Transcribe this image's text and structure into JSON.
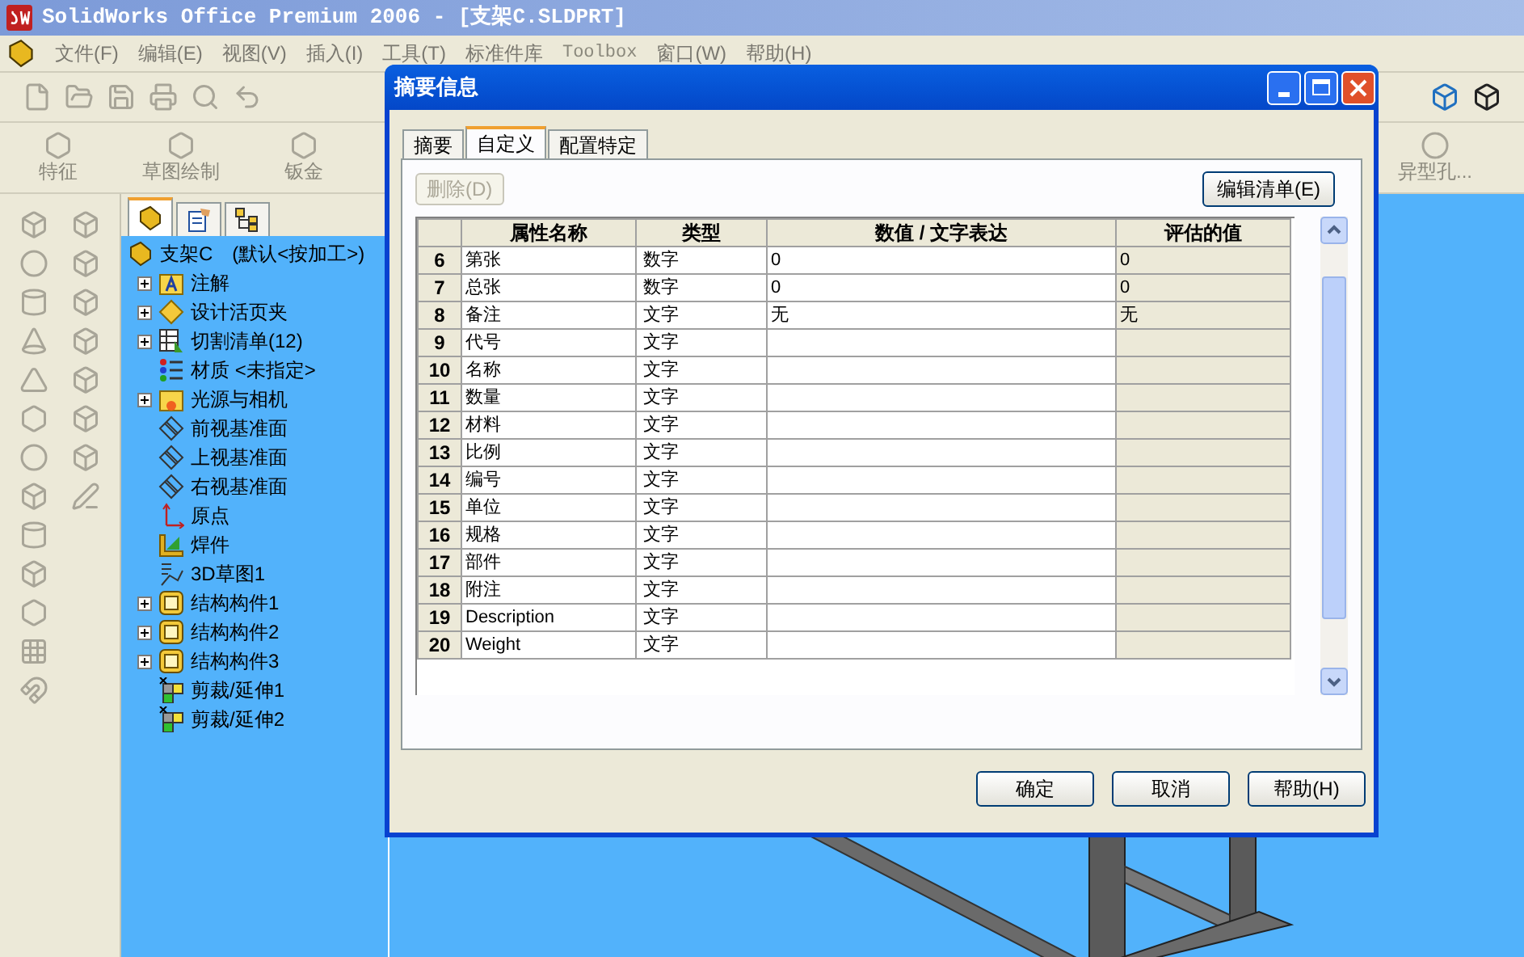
{
  "window": {
    "title": "SolidWorks Office Premium 2006 - [支架C.SLDPRT]"
  },
  "menu": [
    "文件(F)",
    "编辑(E)",
    "视图(V)",
    "插入(I)",
    "工具(T)",
    "标准件库",
    "Toolbox",
    "窗口(W)",
    "帮助(H)"
  ],
  "command_bar": {
    "left": [
      "特征",
      "草图绘制",
      "钣金"
    ],
    "right": [
      "异型孔..."
    ]
  },
  "feature_tree": {
    "tabs": [
      {
        "kind": "feature",
        "selected": true
      },
      {
        "kind": "property",
        "selected": false
      },
      {
        "kind": "configuration",
        "selected": false
      }
    ],
    "root": {
      "label": "支架C",
      "config": "(默认<按加工>)"
    },
    "items": [
      {
        "kind": "annotation",
        "label": "注解",
        "expandable": true
      },
      {
        "kind": "binder",
        "label": "设计活页夹",
        "expandable": true
      },
      {
        "kind": "cutlist",
        "label": "切割清单(12)",
        "expandable": true
      },
      {
        "kind": "material",
        "label": "材质 <未指定>",
        "expandable": false
      },
      {
        "kind": "lights",
        "label": "光源与相机",
        "expandable": true
      },
      {
        "kind": "plane",
        "label": "前视基准面",
        "expandable": false
      },
      {
        "kind": "plane",
        "label": "上视基准面",
        "expandable": false
      },
      {
        "kind": "plane",
        "label": "右视基准面",
        "expandable": false
      },
      {
        "kind": "origin",
        "label": "原点",
        "expandable": false
      },
      {
        "kind": "weldment",
        "label": "焊件",
        "expandable": false
      },
      {
        "kind": "sketch",
        "label": "3D草图1",
        "expandable": false
      },
      {
        "kind": "member",
        "label": "结构构件1",
        "expandable": true
      },
      {
        "kind": "member",
        "label": "结构构件2",
        "expandable": true
      },
      {
        "kind": "member",
        "label": "结构构件3",
        "expandable": true
      },
      {
        "kind": "trim",
        "label": "剪裁/延伸1",
        "expandable": false
      },
      {
        "kind": "trim",
        "label": "剪裁/延伸2",
        "expandable": false
      }
    ]
  },
  "dialog": {
    "title": "摘要信息",
    "tabs": [
      {
        "label": "摘要",
        "selected": false
      },
      {
        "label": "自定义",
        "selected": true
      },
      {
        "label": "配置特定",
        "selected": false
      }
    ],
    "delete_button": {
      "label": "删除(D)",
      "disabled": true
    },
    "edit_list_button": {
      "label": "编辑清单(E)",
      "disabled": false
    },
    "table": {
      "columns": [
        "属性名称",
        "类型",
        "数值 / 文字表达",
        "评估的值"
      ],
      "rows": [
        {
          "number": "6",
          "name": "第张",
          "type": "数字",
          "value": "0",
          "evaluated": "0"
        },
        {
          "number": "7",
          "name": "总张",
          "type": "数字",
          "value": "0",
          "evaluated": "0"
        },
        {
          "number": "8",
          "name": "备注",
          "type": "文字",
          "value": "无",
          "evaluated": "无"
        },
        {
          "number": "9",
          "name": "代号",
          "type": "文字"
        },
        {
          "number": "10",
          "name": "名称",
          "type": "文字"
        },
        {
          "number": "11",
          "name": "数量",
          "type": "文字"
        },
        {
          "number": "12",
          "name": "材料",
          "type": "文字"
        },
        {
          "number": "13",
          "name": "比例",
          "type": "文字"
        },
        {
          "number": "14",
          "name": "编号",
          "type": "文字"
        },
        {
          "number": "15",
          "name": "单位",
          "type": "文字"
        },
        {
          "number": "16",
          "name": "规格",
          "type": "文字"
        },
        {
          "number": "17",
          "name": "部件",
          "type": "文字"
        },
        {
          "number": "18",
          "name": "附注",
          "type": "文字"
        },
        {
          "number": "19",
          "name": "Description",
          "type": "文字"
        },
        {
          "number": "20",
          "name": "Weight",
          "type": "文字"
        }
      ]
    },
    "buttons": [
      "确定",
      "取消",
      "帮助(H)"
    ]
  }
}
